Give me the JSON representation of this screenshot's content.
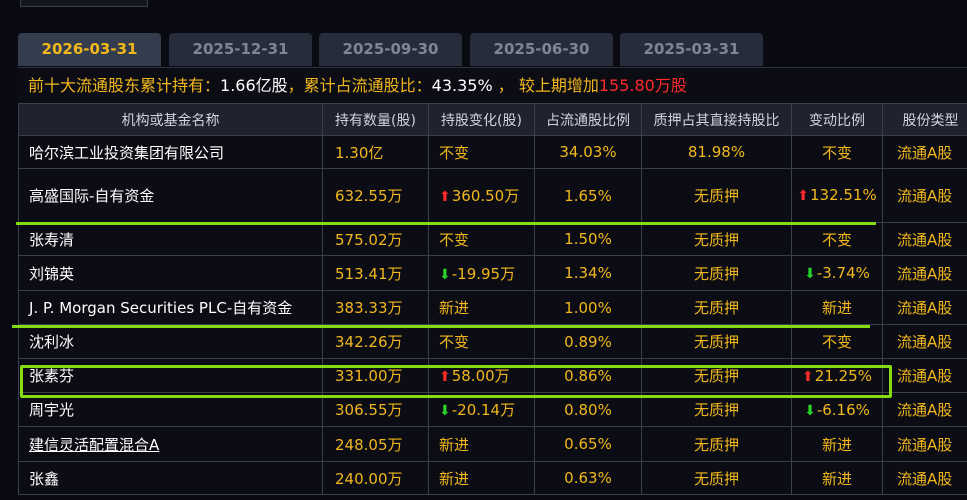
{
  "window": {
    "top_tab_label": ""
  },
  "period_tabs": [
    {
      "label": "2026-03-31",
      "active": true
    },
    {
      "label": "2025-12-31",
      "active": false
    },
    {
      "label": "2025-09-30",
      "active": false
    },
    {
      "label": "2025-06-30",
      "active": false
    },
    {
      "label": "2025-03-31",
      "active": false
    }
  ],
  "summary": {
    "prefix": "前十大流通股东累计持有：",
    "total_shares": "1.66亿股",
    "mid": "，累计占流通股比：",
    "ratio": "43.35%",
    "mid2": " ， 较上期增加",
    "increase": "155.80万股"
  },
  "table": {
    "headers": [
      "机构或基金名称",
      "持有数量(股)",
      "持股变化(股)",
      "占流通股比例",
      "质押占其直接持股比",
      "变动比例",
      "股份类型"
    ],
    "rows": [
      {
        "name": "哈尔滨工业投资集团有限公司",
        "shares": "1.30亿",
        "change": "不变",
        "change_dir": "none",
        "ratio": "34.03%",
        "pledge": "81.98%",
        "pct": "不变",
        "pct_dir": "none",
        "type": "流通A股",
        "link": false
      },
      {
        "name": "高盛国际-自有资金",
        "shares": "632.55万",
        "change": "360.50万",
        "change_dir": "up",
        "ratio": "1.65%",
        "pledge": "无质押",
        "pct": "132.51%",
        "pct_dir": "up",
        "type": "流通A股",
        "link": false
      },
      {
        "name": "张寿清",
        "shares": "575.02万",
        "change": "不变",
        "change_dir": "none",
        "ratio": "1.50%",
        "pledge": "无质押",
        "pct": "不变",
        "pct_dir": "none",
        "type": "流通A股",
        "link": false
      },
      {
        "name": "刘锦英",
        "shares": "513.41万",
        "change": "-19.95万",
        "change_dir": "down",
        "ratio": "1.34%",
        "pledge": "无质押",
        "pct": "-3.74%",
        "pct_dir": "down",
        "type": "流通A股",
        "link": false
      },
      {
        "name": "J. P. Morgan Securities PLC-自有资金",
        "shares": "383.33万",
        "change": "新进",
        "change_dir": "new",
        "ratio": "1.00%",
        "pledge": "无质押",
        "pct": "新进",
        "pct_dir": "new",
        "type": "流通A股",
        "link": false
      },
      {
        "name": "沈利冰",
        "shares": "342.26万",
        "change": "不变",
        "change_dir": "none",
        "ratio": "0.89%",
        "pledge": "无质押",
        "pct": "不变",
        "pct_dir": "none",
        "type": "流通A股",
        "link": false
      },
      {
        "name": "张素芬",
        "shares": "331.00万",
        "change": "58.00万",
        "change_dir": "up",
        "ratio": "0.86%",
        "pledge": "无质押",
        "pct": "21.25%",
        "pct_dir": "up",
        "type": "流通A股",
        "link": false
      },
      {
        "name": "周宇光",
        "shares": "306.55万",
        "change": "-20.14万",
        "change_dir": "down",
        "ratio": "0.80%",
        "pledge": "无质押",
        "pct": "-6.16%",
        "pct_dir": "down",
        "type": "流通A股",
        "link": false
      },
      {
        "name": "建信灵活配置混合A",
        "shares": "248.05万",
        "change": "新进",
        "change_dir": "new",
        "ratio": "0.65%",
        "pledge": "无质押",
        "pct": "新进",
        "pct_dir": "new",
        "type": "流通A股",
        "link": true
      },
      {
        "name": "张鑫",
        "shares": "240.00万",
        "change": "新进",
        "change_dir": "new",
        "ratio": "0.63%",
        "pledge": "无质押",
        "pct": "新进",
        "pct_dir": "new",
        "type": "流通A股",
        "link": false
      }
    ]
  },
  "colors": {
    "accent": "#f2b71c",
    "up": "#ff2a2a",
    "down": "#27d427",
    "link": "#2f95ff",
    "annotation": "#84dd10"
  },
  "icons": {
    "up": "arrow-up-icon",
    "down": "arrow-down-icon"
  }
}
